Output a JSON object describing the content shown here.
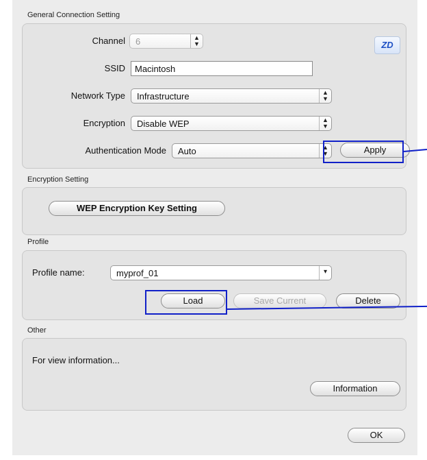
{
  "general": {
    "title": "General Connection Setting",
    "channel_label": "Channel",
    "channel_value": "6",
    "ssid_label": "SSID",
    "ssid_value": "Macintosh",
    "network_type_label": "Network Type",
    "network_type_value": "Infrastructure",
    "encryption_label": "Encryption",
    "encryption_value": "Disable WEP",
    "auth_mode_label": "Authentication Mode",
    "auth_mode_value": "Auto",
    "apply_label": "Apply",
    "logo_text": "ZD"
  },
  "encryption_section": {
    "title": "Encryption Setting",
    "wep_button_label": "WEP Encryption Key Setting"
  },
  "profile": {
    "title": "Profile",
    "name_label": "Profile name:",
    "name_value": "myprof_01",
    "load_label": "Load",
    "save_current_label": "Save Current",
    "delete_label": "Delete"
  },
  "other": {
    "title": "Other",
    "info_text": "For view information...",
    "information_label": "Information"
  },
  "footer": {
    "ok_label": "OK"
  },
  "colors": {
    "callout": "#1020c8",
    "panel_bg": "#ececec"
  },
  "icons": {
    "popup_arrows": "up-down-arrows-icon",
    "logo": "zd-logo-icon"
  }
}
